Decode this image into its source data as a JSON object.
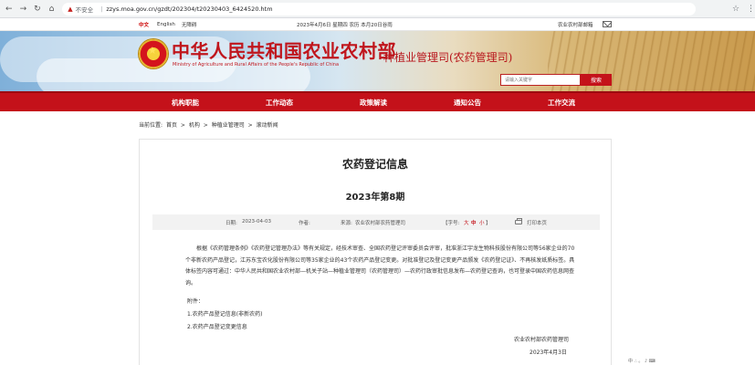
{
  "browser": {
    "security": "不安全",
    "url": "zzys.moa.gov.cn/gzdt/202304/t20230403_6424520.htm"
  },
  "top_strip": {
    "lang_cn": "中文",
    "lang_en": "English",
    "lang_access": "无障碍",
    "date": "2023年4月6日 星期四 农历 本月20日谷雨",
    "mail": "农业农村部邮箱"
  },
  "header": {
    "title_cn": "中华人民共和国农业农村部",
    "title_en": "Ministry of Agriculture and Rural Affairs of the People's Republic of China",
    "dept": "种植业管理司(农药管理司)",
    "search_placeholder": "请输入关键字",
    "search_button": "搜索"
  },
  "nav": [
    "机构职能",
    "工作动态",
    "政策解读",
    "通知公告",
    "工作交流"
  ],
  "breadcrumb": {
    "prefix": "当前位置:",
    "items": [
      "首页",
      "机构",
      "种植业管理司",
      "滚动新闻"
    ],
    "sep": ">"
  },
  "article": {
    "title": "农药登记信息",
    "subtitle": "2023年第8期",
    "meta": {
      "date_label": "日期:",
      "date": "2023-04-03",
      "author_label": "作者:",
      "source_label": "来源:",
      "source": "农业农村部农药管理司",
      "font_label": "【字号:",
      "font_big": "大",
      "font_mid": "中",
      "font_small": "小",
      "font_close": "】",
      "print": "打印本页"
    },
    "paragraphs": [
      "根据《农药管理条例》《农药登记管理办法》等有关规定，经技术审查、全国农药登记评审委员会评审，批准浙江宇龙生物科技股份有限公司等56家企业的70个非新农药产品登记，江苏东宝农化股份有限公司等35家企业的43个农药产品登记变更。对批准登记及登记变更产品颁发《农药登记证》、不再核发纸质标签。具体标签内容可通过：中华人民共和国农业农村部—机关子站—种植业管理司（农药管理司）—农药行政审批信息发布—农药登记查询，也可登录中国农药信息网查询。"
    ],
    "attach_label": "附件：",
    "attachments": [
      "1.农药产品登记信息(非新农药)",
      "2.农药产品登记变更信息"
    ],
    "sign_org": "农业农村部农药管理司",
    "sign_date": "2023年4月3日"
  },
  "tray": "中 ∴ 。 ♪ ⌨"
}
